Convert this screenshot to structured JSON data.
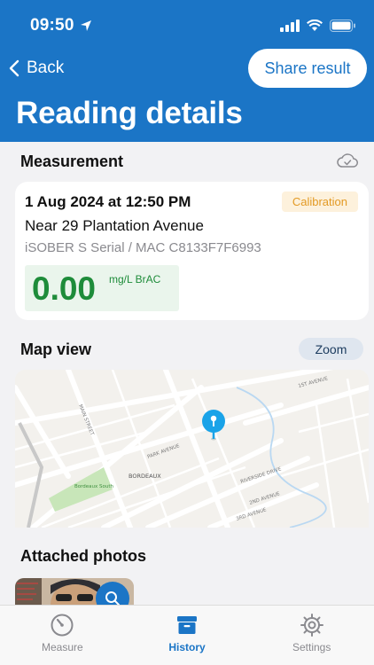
{
  "status_bar": {
    "time": "09:50"
  },
  "nav": {
    "back_label": "Back",
    "share_label": "Share result",
    "title": "Reading details"
  },
  "measurement": {
    "section_title": "Measurement",
    "datetime": "1 Aug 2024 at 12:50 PM",
    "badge": "Calibration",
    "address": "Near 29 Plantation Avenue",
    "device": "iSOBER S Serial / MAC C8133F7F6993",
    "value": "0.00",
    "unit": "mg/L BrAC"
  },
  "map_view": {
    "section_title": "Map view",
    "zoom_label": "Zoom",
    "labels": {
      "bordeaux": "BORDEAUX",
      "bordeaux_south": "Bordeaux South",
      "main_street": "MAIN STREET",
      "park_avenue": "PARK AVENUE",
      "riverside_drive": "RIVERSIDE DRIVE",
      "second_avenue": "2ND AVENUE",
      "third_avenue": "3RD AVENUE",
      "first_avenue": "1ST AVENUE"
    }
  },
  "photos": {
    "section_title": "Attached photos"
  },
  "tabs": [
    {
      "label": "Measure",
      "icon": "gauge-icon",
      "active": false
    },
    {
      "label": "History",
      "icon": "archive-box-icon",
      "active": true
    },
    {
      "label": "Settings",
      "icon": "gear-icon",
      "active": false
    }
  ],
  "colors": {
    "brand": "#1b75c6",
    "badge_bg": "#fdf1dc",
    "badge_text": "#e39a24",
    "reading_green": "#1e8c3a",
    "reading_bg": "#eaf5ec"
  }
}
